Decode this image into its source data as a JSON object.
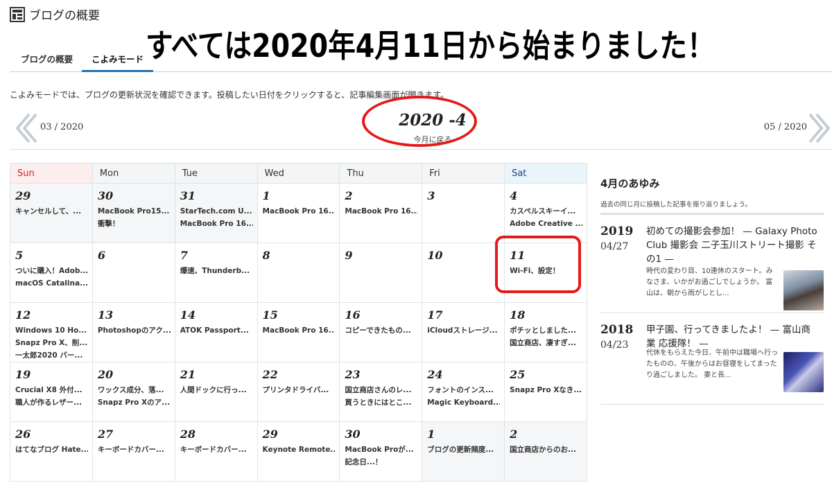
{
  "header": {
    "title": "ブログの概要",
    "icon": "dashboard-layout-icon"
  },
  "banner": "すべては2020年4月11日から始まりました！",
  "tabs": [
    {
      "label": "ブログの概要"
    },
    {
      "label": "こよみモード",
      "active": true
    }
  ],
  "description": "こよみモードでは、ブログの更新状況を確認できます。投稿したい日付をクリックすると、記事編集画面が開きます。",
  "nav": {
    "prev": "03 / 2020",
    "next": "05 / 2020",
    "current": "2020 -4",
    "back": "今月に戻る"
  },
  "calendar": {
    "weekdays": [
      "Sun",
      "Mon",
      "Tue",
      "Wed",
      "Thu",
      "Fri",
      "Sat"
    ],
    "weeks": [
      [
        {
          "day": "29",
          "posts": [
            "キャンセルして、..."
          ]
        },
        {
          "day": "30",
          "posts": [
            "MacBook Pro15...",
            "衝撃！"
          ]
        },
        {
          "day": "31",
          "posts": [
            "StarTech.com U...",
            "MacBook Pro 16..."
          ]
        },
        {
          "day": "1",
          "posts": [
            "MacBook Pro 16..."
          ]
        },
        {
          "day": "2",
          "posts": [
            "MacBook Pro 16..."
          ]
        },
        {
          "day": "3",
          "posts": []
        },
        {
          "day": "4",
          "posts": [
            "カスペルスキーイ...",
            "Adobe Creative ..."
          ]
        }
      ],
      [
        {
          "day": "5",
          "posts": [
            "ついに購入！Adob...",
            "macOS Catalina..."
          ]
        },
        {
          "day": "6",
          "posts": []
        },
        {
          "day": "7",
          "posts": [
            "爆速、Thunderb..."
          ]
        },
        {
          "day": "8",
          "posts": []
        },
        {
          "day": "9",
          "posts": []
        },
        {
          "day": "10",
          "posts": []
        },
        {
          "day": "11",
          "posts": [
            "Wi-Fi、設定！"
          ]
        }
      ],
      [
        {
          "day": "12",
          "posts": [
            "Windows 10 Ho...",
            "Snapz Pro X、削...",
            "一太郎2020 バー..."
          ]
        },
        {
          "day": "13",
          "posts": [
            "Photoshopのアク..."
          ]
        },
        {
          "day": "14",
          "posts": [
            "ATOK Passport..."
          ]
        },
        {
          "day": "15",
          "posts": [
            "MacBook Pro 16..."
          ]
        },
        {
          "day": "16",
          "posts": [
            "コピーできたもの..."
          ]
        },
        {
          "day": "17",
          "posts": [
            "iCloudストレージ..."
          ]
        },
        {
          "day": "18",
          "posts": [
            "ポチッとしました...",
            "国立商店、凄すぎ..."
          ]
        }
      ],
      [
        {
          "day": "19",
          "posts": [
            "Crucial X8 外付...",
            "職人が作るレザー..."
          ]
        },
        {
          "day": "20",
          "posts": [
            "ワックス成分、落...",
            "Snapz Pro Xのア..."
          ]
        },
        {
          "day": "21",
          "posts": [
            "人間ドックに行っ..."
          ]
        },
        {
          "day": "22",
          "posts": [
            "プリンタドライバ..."
          ]
        },
        {
          "day": "23",
          "posts": [
            "国立商店さんのレ...",
            "買うときにはとこ..."
          ]
        },
        {
          "day": "24",
          "posts": [
            "フォントのインス...",
            "Magic Keyboard..."
          ]
        },
        {
          "day": "25",
          "posts": [
            "Snapz Pro Xなき..."
          ]
        }
      ],
      [
        {
          "day": "26",
          "posts": [
            "はてなブログ Hate..."
          ]
        },
        {
          "day": "27",
          "posts": [
            "キーボードカバー..."
          ]
        },
        {
          "day": "28",
          "posts": [
            "キーボードカバー..."
          ]
        },
        {
          "day": "29",
          "posts": [
            "Keynote Remote..."
          ]
        },
        {
          "day": "30",
          "posts": [
            "MacBook Proが...",
            "記念日...！"
          ]
        },
        {
          "day": "1",
          "posts": [
            "ブログの更新頻度..."
          ]
        },
        {
          "day": "2",
          "posts": [
            "国立商店からのお..."
          ]
        }
      ]
    ]
  },
  "sidebar": {
    "title": "4月のあゆみ",
    "subtitle": "過去の同じ月に投稿した記事を振り返りましょう。",
    "entries": [
      {
        "year": "2019",
        "date": "04/27",
        "title": "初めての撮影会参加！ — Galaxy Photo Club 撮影会 二子玉川ストリート撮影 その1 —",
        "excerpt": "時代の変わり目、10連休のスタート。みなさま、いかがお過ごしでしょうか。 富山は、朝から雨がしとし..."
      },
      {
        "year": "2018",
        "date": "04/23",
        "title": "甲子園、行ってきましたよ！ — 富山商業 応援隊！ —",
        "excerpt": "代休をもらえた今日、午前中は職場へ行ったものの、午後からはお昼寝をしてまったり過ごしました。 妻と長..."
      }
    ]
  },
  "colors": {
    "accent": "#2271b1",
    "annotation": "#e41a1a",
    "sunday": "#c22222",
    "saturday": "#1a3d8a"
  }
}
